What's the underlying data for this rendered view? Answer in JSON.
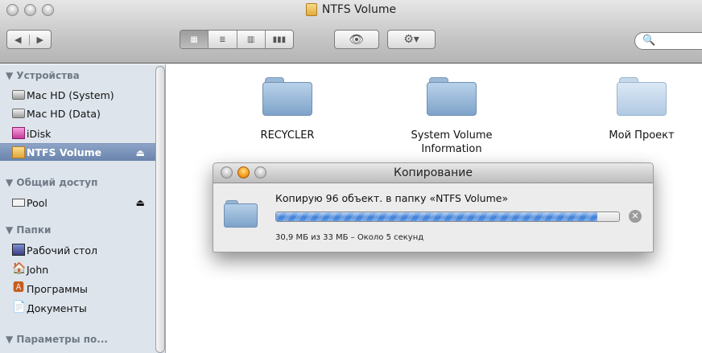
{
  "window": {
    "title": "NTFS Volume"
  },
  "toolbar": {
    "back_glyph": "◀",
    "forward_glyph": "▶",
    "view_icons": [
      "▦",
      "≣",
      "▥",
      "▮▮▮"
    ],
    "quicklook_glyph": "👁",
    "action_glyph": "⚙▾",
    "search_glyph": "🔍"
  },
  "sidebar": {
    "sections": [
      {
        "label": "▼ Устройства"
      },
      {
        "label": "▼ Общий доступ"
      },
      {
        "label": "▼ Папки"
      },
      {
        "label": "▼ Параметры по..."
      }
    ],
    "devices": [
      {
        "label": "Mac HD (System)",
        "icon": "hard-drive-icon"
      },
      {
        "label": "Mac HD (Data)",
        "icon": "hard-drive-icon"
      },
      {
        "label": "iDisk",
        "icon": "idisk-icon"
      },
      {
        "label": "NTFS Volume",
        "icon": "ntfs-drive-icon",
        "selected": true
      }
    ],
    "shared": [
      {
        "label": "Pool",
        "icon": "network-icon"
      }
    ],
    "folders": [
      {
        "label": "Рабочий стол",
        "icon": "desktop-icon"
      },
      {
        "label": "John",
        "icon": "home-icon",
        "glyph": "🏠"
      },
      {
        "label": "Программы",
        "icon": "applications-icon",
        "glyph": "🅰"
      },
      {
        "label": "Документы",
        "icon": "documents-icon",
        "glyph": "📄"
      }
    ],
    "eject_glyph": "⏏"
  },
  "content": {
    "items": [
      {
        "name": "RECYCLER"
      },
      {
        "name": "System Volume Information"
      },
      {
        "name": "Мой Проект"
      }
    ]
  },
  "copy_dialog": {
    "title": "Копирование",
    "message": "Копирую 96 объект. в папку «NTFS Volume»",
    "status": "30,9 МБ из 33 МБ – Около 5 секунд",
    "progress_fraction": 0.936,
    "cancel_glyph": "✕"
  }
}
